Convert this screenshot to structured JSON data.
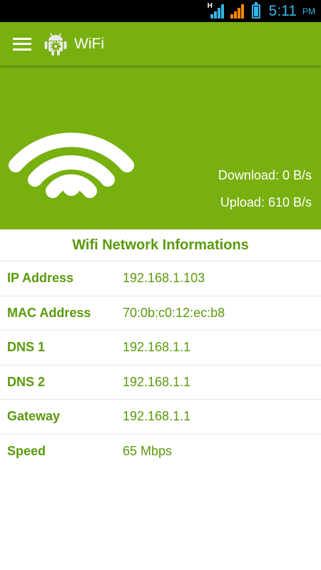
{
  "status_bar": {
    "network_type": "H",
    "time": "5:11",
    "ampm": "PM",
    "signal_icons": [
      "signal-h-icon",
      "signal-orange-icon"
    ],
    "battery_icon": "battery-icon",
    "colors": {
      "clock": "#33b5e5",
      "signal_1": "#33b5e5",
      "signal_2": "#ff8800"
    }
  },
  "action_bar": {
    "menu_icon": "hamburger-menu-icon",
    "app_icon": "android-gear-icon",
    "title": "WiFi",
    "color": "#78b010"
  },
  "hero": {
    "icon": "wifi-icon",
    "download": "Download: 0 B/s",
    "upload": "Upload: 610 B/s"
  },
  "info": {
    "title": "Wifi Network Informations",
    "rows": [
      {
        "label": "IP Address",
        "value": "192.168.1.103"
      },
      {
        "label": "MAC Address",
        "value": "70:0b:c0:12:ec:b8"
      },
      {
        "label": "DNS 1",
        "value": "192.168.1.1"
      },
      {
        "label": "DNS 2",
        "value": "192.168.1.1"
      },
      {
        "label": "Gateway",
        "value": "192.168.1.1"
      },
      {
        "label": "Speed",
        "value": "65 Mbps"
      }
    ],
    "text_color": "#5a9a0a"
  }
}
